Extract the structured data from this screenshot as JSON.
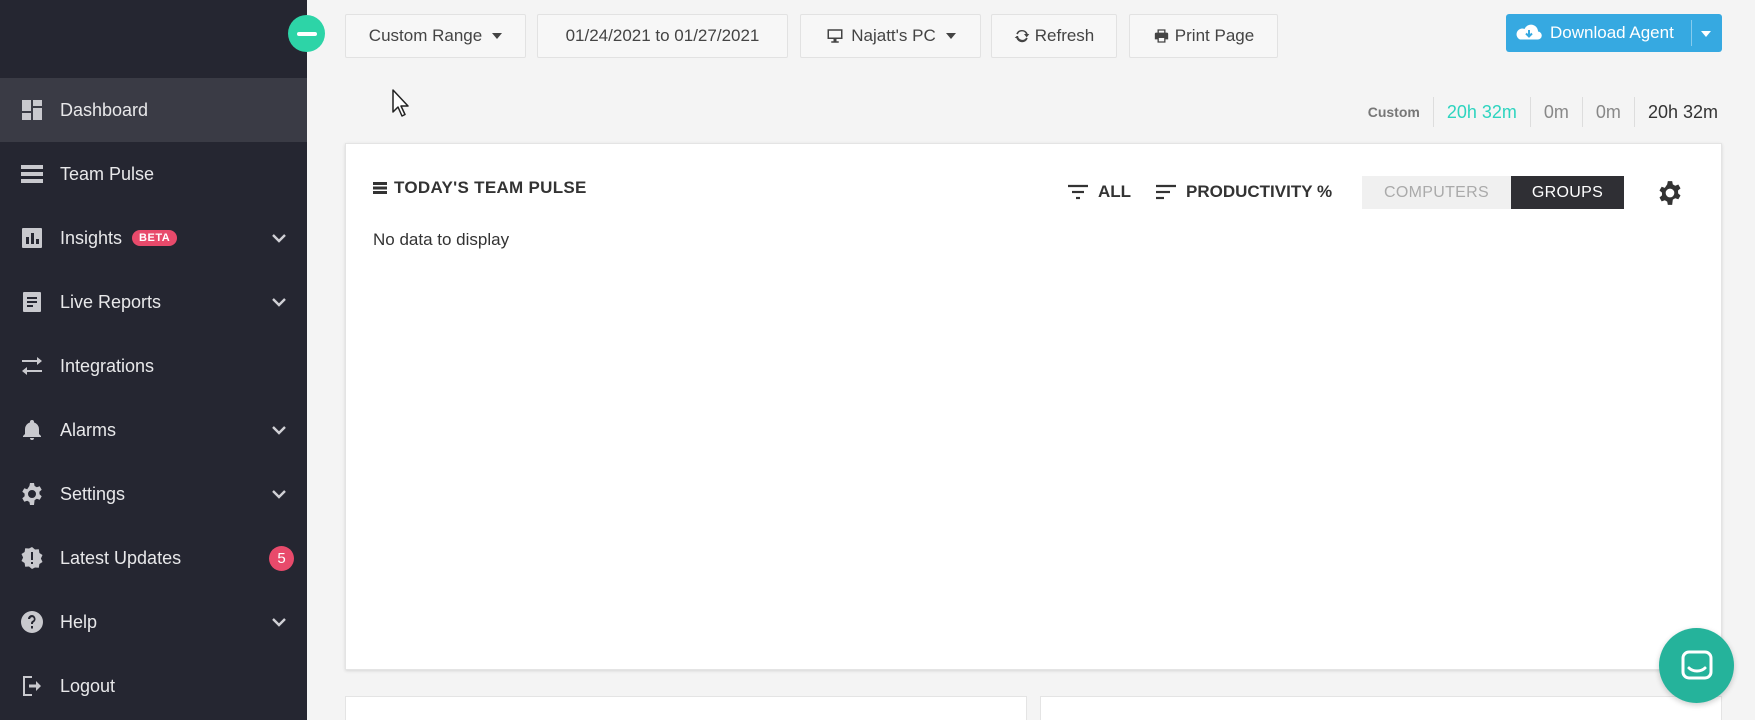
{
  "sidebar": {
    "items": [
      {
        "label": "Dashboard"
      },
      {
        "label": "Team Pulse"
      },
      {
        "label": "Insights",
        "badge": "BETA"
      },
      {
        "label": "Live Reports"
      },
      {
        "label": "Integrations"
      },
      {
        "label": "Alarms"
      },
      {
        "label": "Settings"
      },
      {
        "label": "Latest Updates",
        "count": "5"
      },
      {
        "label": "Help"
      },
      {
        "label": "Logout"
      }
    ]
  },
  "toolbar": {
    "range_label": "Custom Range",
    "date_range": "01/24/2021 to 01/27/2021",
    "computer_label": "Najatt's PC",
    "refresh_label": "Refresh",
    "print_label": "Print Page",
    "download_label": "Download Agent"
  },
  "time_summary": {
    "label": "Custom",
    "productive": "20h 32m",
    "unproductive": "0m",
    "undefined": "0m",
    "total": "20h 32m"
  },
  "panel": {
    "title": "TODAY'S TEAM PULSE",
    "filter_all": "ALL",
    "filter_productivity": "PRODUCTIVITY %",
    "toggle_computers": "COMPUTERS",
    "toggle_groups": "GROUPS",
    "empty_message": "No data to display"
  },
  "colors": {
    "sidebar_bg": "#252631",
    "accent_teal": "#2dd4a7",
    "download_blue": "#36a9e1",
    "badge_red": "#e84a6b"
  }
}
